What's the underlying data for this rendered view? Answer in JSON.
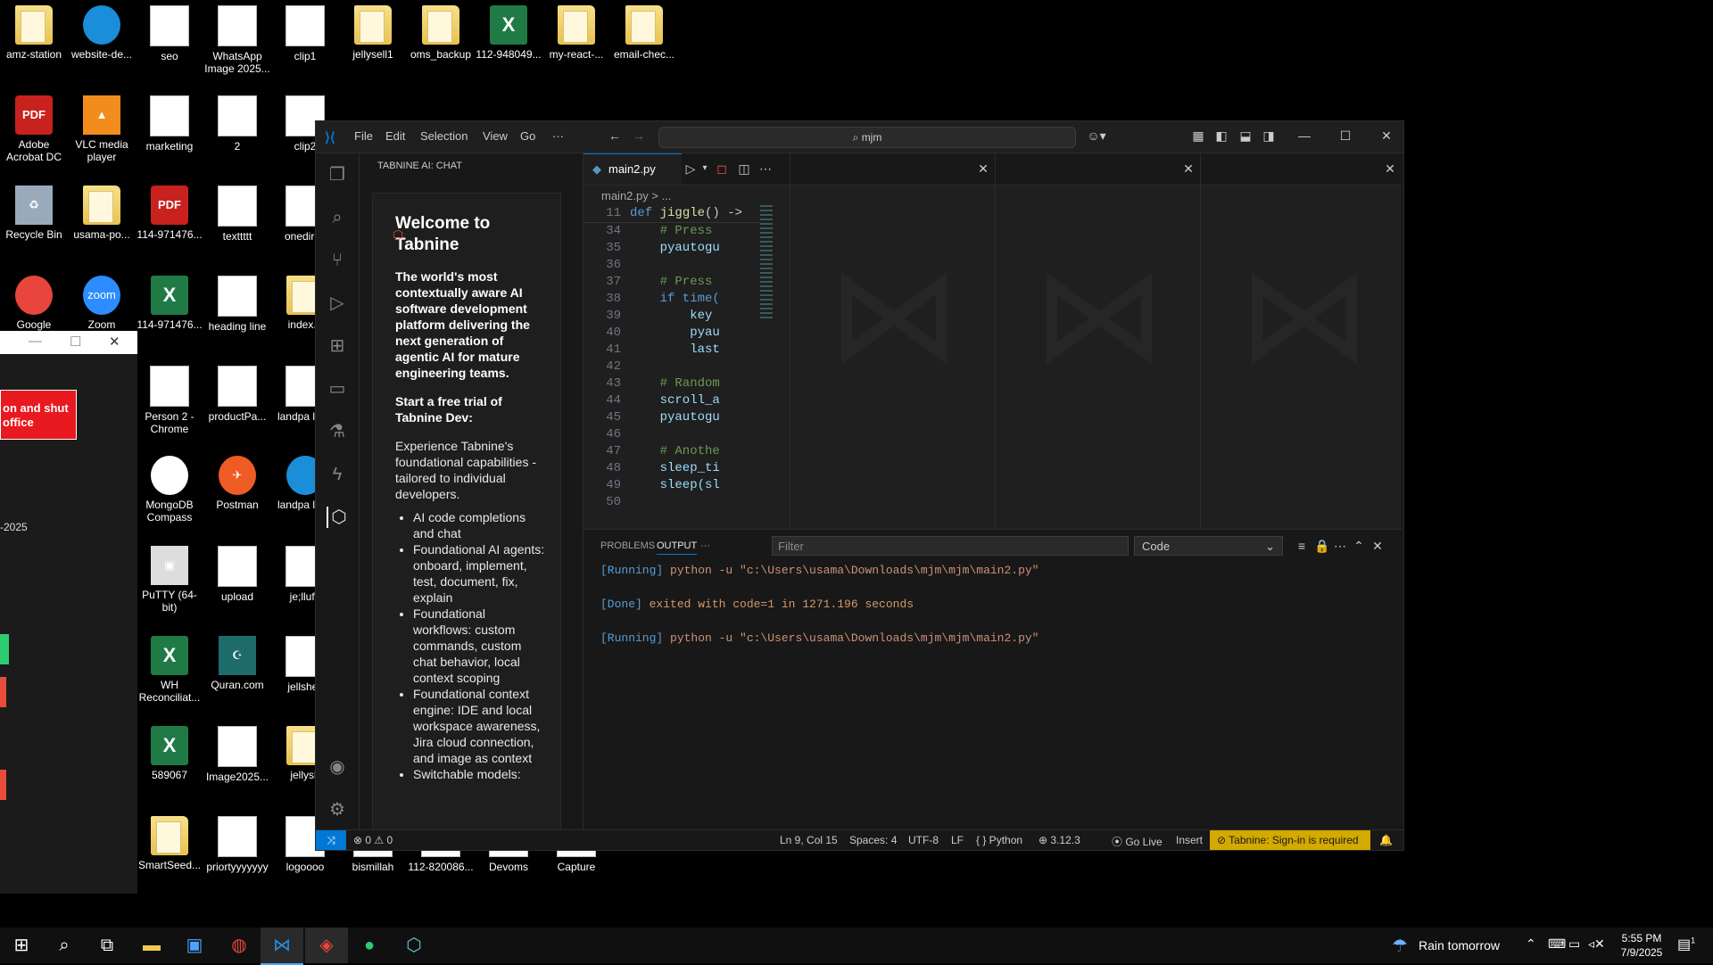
{
  "desktop_icons": [
    {
      "label": "amz-station",
      "type": "folder"
    },
    {
      "label": "website-de...",
      "type": "edge"
    },
    {
      "label": "seo",
      "type": "image"
    },
    {
      "label": "WhatsApp Image 2025...",
      "type": "doc"
    },
    {
      "label": "clip1",
      "type": "image"
    },
    {
      "label": "jellysell1",
      "type": "folder"
    },
    {
      "label": "oms_backup",
      "type": "folder"
    },
    {
      "label": "112-948049...",
      "type": "excel"
    },
    {
      "label": "my-react-...",
      "type": "folder"
    },
    {
      "label": "email-chec...",
      "type": "folder"
    },
    {
      "label": "Adobe Acrobat DC",
      "type": "pdf"
    },
    {
      "label": "VLC media player",
      "type": "vlc"
    },
    {
      "label": "marketing",
      "type": "image"
    },
    {
      "label": "2",
      "type": "doc"
    },
    {
      "label": "clip2",
      "type": "image"
    },
    {
      "label": "Recycle Bin",
      "type": "bin"
    },
    {
      "label": "usama-po...",
      "type": "folder"
    },
    {
      "label": "114-971476...",
      "type": "pdf"
    },
    {
      "label": "texttttt",
      "type": "doc"
    },
    {
      "label": "onedirec",
      "type": "image"
    },
    {
      "label": "Google",
      "type": "chrome"
    },
    {
      "label": "Zoom",
      "type": "zoom"
    },
    {
      "label": "114-971476...",
      "type": "excel"
    },
    {
      "label": "heading line",
      "type": "doc"
    },
    {
      "label": "index.h",
      "type": "folder"
    },
    {
      "label": "Person 2 - Chrome",
      "type": "doc"
    },
    {
      "label": "productPa...",
      "type": "image"
    },
    {
      "label": "landpa logo",
      "type": "image"
    },
    {
      "label": "MongoDB Compass",
      "type": "mongo"
    },
    {
      "label": "Postman",
      "type": "postman"
    },
    {
      "label": "landpa logo",
      "type": "edge"
    },
    {
      "label": "PuTTY (64-bit)",
      "type": "putty"
    },
    {
      "label": "upload",
      "type": "doc"
    },
    {
      "label": "je;llufe",
      "type": "image"
    },
    {
      "label": "WH Reconciliat...",
      "type": "excel"
    },
    {
      "label": "Quran.com",
      "type": "quran"
    },
    {
      "label": "jellshell",
      "type": "image"
    },
    {
      "label": "589067",
      "type": "excel"
    },
    {
      "label": "Image2025...",
      "type": "image"
    },
    {
      "label": "jellysh",
      "type": "folder"
    },
    {
      "label": "SmartSeed...",
      "type": "folder"
    },
    {
      "label": "priortyyyyyyy",
      "type": "image"
    },
    {
      "label": "logoooo",
      "type": "image"
    },
    {
      "label": "bismillah",
      "type": "image"
    },
    {
      "label": "112-820086...",
      "type": "image"
    },
    {
      "label": "Devoms",
      "type": "image"
    },
    {
      "label": "Capture",
      "type": "image"
    }
  ],
  "left_window": {
    "button_text": "on and shut office",
    "date_text": "-2025"
  },
  "vscode": {
    "menu": [
      "File",
      "Edit",
      "Selection",
      "View",
      "Go",
      "···"
    ],
    "command_center": "mjm",
    "tabnine": {
      "header": "TABNINE AI: CHAT",
      "title": "Welcome to Tabnine",
      "tagline": "The world's most contextually aware AI software development platform delivering the next generation of agentic AI for mature engineering teams.",
      "trial": "Start a free trial of Tabnine Dev:",
      "intro": "Experience Tabnine's foundational capabilities - tailored to individual developers.",
      "bullets": [
        "AI code completions and chat",
        "Foundational AI agents: onboard, implement, test, document, fix, explain",
        "Foundational workflows: custom commands, custom chat behavior, local context scoping",
        "Foundational context engine: IDE and local workspace awareness, Jira cloud connection, and image as context",
        "Switchable models:"
      ]
    },
    "editor": {
      "tab": "main2.py",
      "breadcrumb": "main2.py > ...",
      "sticky": {
        "ln": "11",
        "text": "def jiggle() ->"
      },
      "lines": [
        {
          "ln": "34",
          "text": "    # Press"
        },
        {
          "ln": "35",
          "text": "    pyautogu"
        },
        {
          "ln": "36",
          "text": ""
        },
        {
          "ln": "37",
          "text": "    # Press"
        },
        {
          "ln": "38",
          "text": "    if time("
        },
        {
          "ln": "39",
          "text": "        key"
        },
        {
          "ln": "40",
          "text": "        pyau"
        },
        {
          "ln": "41",
          "text": "        last"
        },
        {
          "ln": "42",
          "text": ""
        },
        {
          "ln": "43",
          "text": "    # Random"
        },
        {
          "ln": "44",
          "text": "    scroll_a"
        },
        {
          "ln": "45",
          "text": "    pyautogu"
        },
        {
          "ln": "46",
          "text": ""
        },
        {
          "ln": "47",
          "text": "    # Anothe"
        },
        {
          "ln": "48",
          "text": "    sleep_ti"
        },
        {
          "ln": "49",
          "text": "    sleep(sl"
        },
        {
          "ln": "50",
          "text": ""
        }
      ]
    },
    "panel": {
      "tabs": [
        "PROBLEMS",
        "OUTPUT",
        "···"
      ],
      "filter_placeholder": "Filter",
      "channel": "Code",
      "output": [
        {
          "tag": "[Running]",
          "text": " python -u \"c:\\Users\\usama\\Downloads\\mjm\\mjm\\main2.py\""
        },
        {
          "tag": "[Done]",
          "text": " exited with code=1 in 1271.196 seconds"
        },
        {
          "tag": "[Running]",
          "text": " python -u \"c:\\Users\\usama\\Downloads\\mjm\\mjm\\main2.py\""
        }
      ]
    },
    "status": {
      "errors": "0",
      "warnings": "0",
      "position": "Ln 9, Col 15",
      "spaces": "Spaces: 4",
      "encoding": "UTF-8",
      "eol": "LF",
      "language": "{ } Python",
      "version": "3.12.3",
      "golive": "Go Live",
      "mode": "Insert",
      "tabnine": "Tabnine: Sign-in is required"
    }
  },
  "taskbar": {
    "weather": "Rain tomorrow",
    "time": "5:55 PM",
    "date": "7/9/2025",
    "notif_count": "1"
  },
  "colors": {
    "accent": "#0078d4",
    "tabnine_status": "#d4a900",
    "desktop_bg": "#000000"
  }
}
